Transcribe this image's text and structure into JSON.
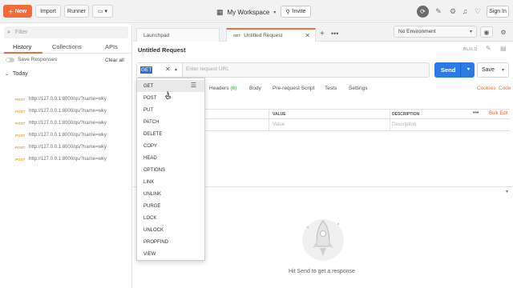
{
  "topbar": {
    "new_label": "New",
    "import_label": "Import",
    "runner_label": "Runner",
    "workspace_label": "My Workspace",
    "invite_label": "Invite",
    "signin_label": "Sign In"
  },
  "sidebar": {
    "filter_placeholder": "Filter",
    "tabs": [
      "History",
      "Collections",
      "APIs"
    ],
    "save_responses_label": "Save Responses",
    "clear_all_label": "Clear all",
    "group_label": "Today",
    "history": [
      {
        "method": "POST",
        "url": "http://127.0.0.1:8000/qs/?name=wky"
      },
      {
        "method": "POST",
        "url": "http://127.0.0.1:8000/qs/?name=wky"
      },
      {
        "method": "POST",
        "url": "http://127.0.0.1:8000/qs/?name=wky"
      },
      {
        "method": "POST",
        "url": "http://127.0.0.1:8000/qs/?name=wky"
      },
      {
        "method": "POST",
        "url": "http://127.0.0.1:8000/qs/?name=wky"
      },
      {
        "method": "POST",
        "url": "http://127.0.0.1:8000/qs/?name=wky"
      }
    ]
  },
  "tabs": {
    "launchpad_label": "Launchpad",
    "active_method": "GET",
    "active_label": "Untitled Request",
    "environment": "No Environment"
  },
  "request": {
    "title": "Untitled Request",
    "build_label": "BUILD",
    "method": "GET",
    "url_placeholder": "Enter request URL",
    "send_label": "Send",
    "save_label": "Save",
    "tabs": {
      "headers": "Headers",
      "headers_count": "(6)",
      "body": "Body",
      "prerequest": "Pre-request Script",
      "tests": "Tests",
      "settings": "Settings"
    },
    "cookies_label": "Cookies",
    "code_label": "Code"
  },
  "params": {
    "col_value": "VALUE",
    "col_description": "DESCRIPTION",
    "bulk_edit": "Bulk Edit",
    "value_placeholder": "Value",
    "description_placeholder": "Description"
  },
  "response": {
    "hint": "Hit Send to get a response"
  },
  "methods": [
    "GET",
    "POST",
    "PUT",
    "PATCH",
    "DELETE",
    "COPY",
    "HEAD",
    "OPTIONS",
    "LINK",
    "UNLINK",
    "PURGE",
    "LOCK",
    "UNLOCK",
    "PROPFIND",
    "VIEW"
  ],
  "colors": {
    "accent": "#f26b3a",
    "send": "#2c7be5",
    "post_method": "#e8a33d",
    "get_method": "#2f9e44"
  }
}
